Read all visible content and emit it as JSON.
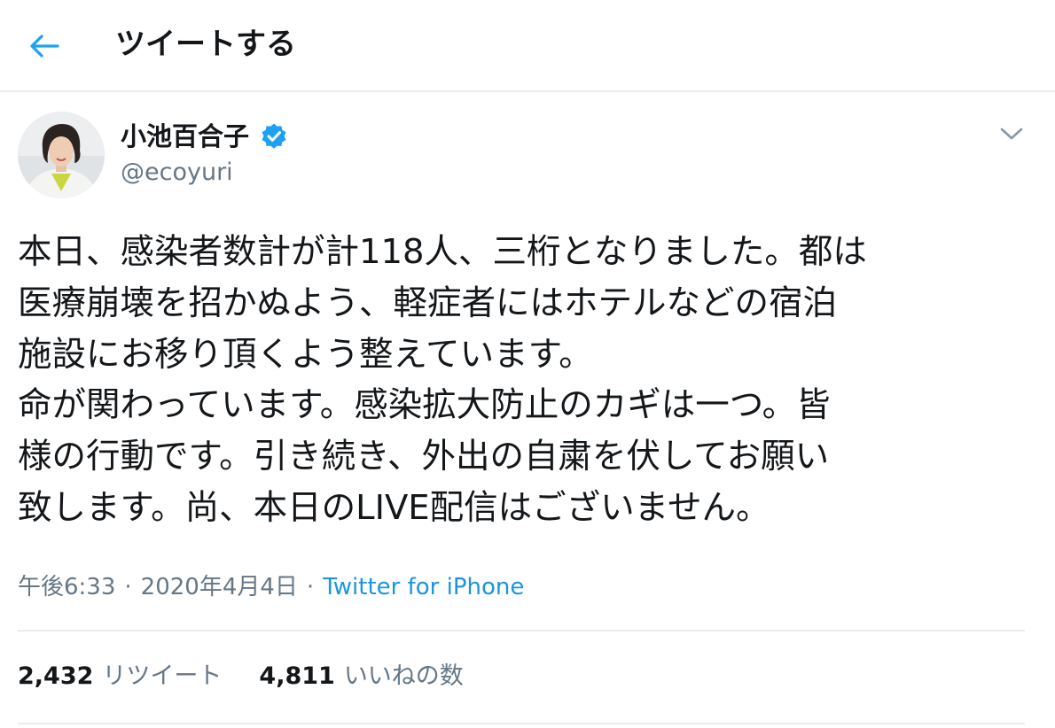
{
  "header": {
    "back_icon": "arrow-left-icon",
    "title": "ツイートする"
  },
  "author": {
    "display_name": "小池百合子",
    "handle": "@ecoyuri",
    "verified_icon": "verified-badge-icon",
    "menu_icon": "chevron-down-icon"
  },
  "tweet": {
    "lines": [
      "本日、感染者数計が計118人、三桁となりました。都は",
      "医療崩壊を招かぬよう、軽症者にはホテルなどの宿泊",
      "施設にお移り頂くよう整えています。",
      "命が関わっています。感染拡大防止のカギは一つ。皆",
      "様の行動です。引き続き、外出の自粛を伏してお願い",
      "致します。尚、本日のLIVE配信はございません。"
    ],
    "time": "午後6:33",
    "separator": "·",
    "date": "2020年4月4日",
    "source": "Twitter for iPhone"
  },
  "stats": {
    "retweets_count": "2,432",
    "retweets_label": "リツイート",
    "likes_count": "4,811",
    "likes_label": "いいねの数"
  },
  "colors": {
    "accent": "#1da1f2",
    "link": "#1b95e0",
    "secondary_text": "#657786",
    "divider": "#e6ecf0"
  }
}
